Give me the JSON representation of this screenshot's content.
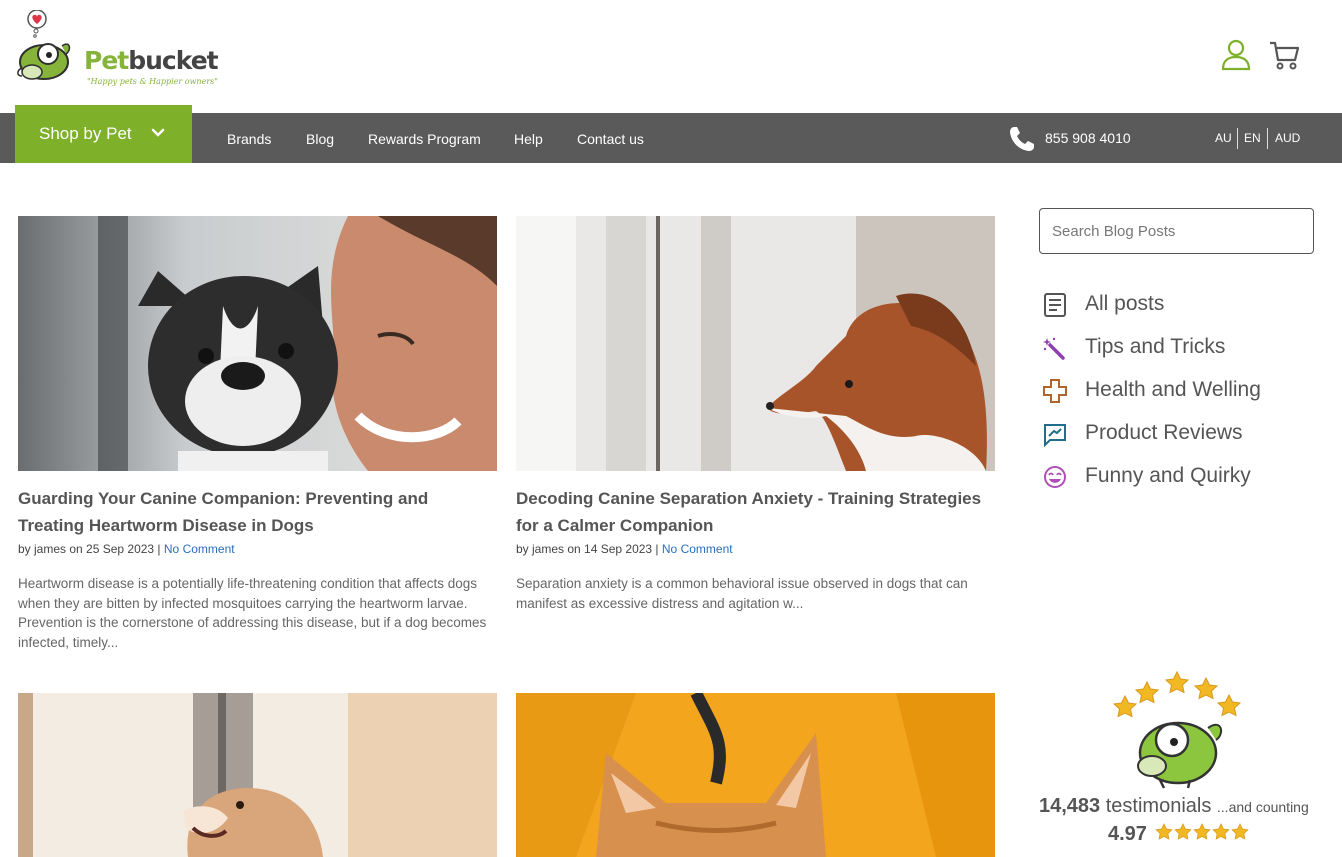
{
  "brand": {
    "name_part1": "Pet",
    "name_part2": "bucket",
    "tagline": "\"Happy pets & Happier owners\""
  },
  "header": {
    "icons": [
      "user-icon",
      "cart-icon"
    ]
  },
  "nav": {
    "shop_by_pet": "Shop by Pet",
    "links": [
      "Brands",
      "Blog",
      "Rewards Program",
      "Help",
      "Contact us"
    ],
    "phone": "855 908 4010",
    "locale": [
      "AU",
      "EN",
      "AUD"
    ]
  },
  "colors": {
    "brand_green": "#7eb02a",
    "nav_gray": "#5a5a5a",
    "link_blue": "#2a6ebb"
  },
  "posts": [
    {
      "title": "Guarding Your Canine Companion: Preventing and Treating Heartworm Disease in Dogs",
      "meta": "by james on 25 Sep 2023 |",
      "comments": "No Comment",
      "excerpt": "Heartworm disease is a potentially life-threatening condition that affects dogs when they are bitten by infected mosquitoes carrying the heartworm larvae. Prevention is the cornerstone of addressing this disease, but if a dog becomes infected, timely..."
    },
    {
      "title": "Decoding Canine Separation Anxiety - Training Strategies for a Calmer Companion",
      "meta": "by james on 14 Sep 2023 |",
      "comments": "No Comment",
      "excerpt": "Separation anxiety is a common behavioral issue observed in dogs that can manifest as excessive distress and agitation w..."
    }
  ],
  "sidebar": {
    "search_placeholder": "Search Blog Posts",
    "categories": [
      {
        "label": "All posts",
        "icon": "document-icon"
      },
      {
        "label": "Tips and Tricks",
        "icon": "magic-wand-icon"
      },
      {
        "label": "Health and Welling",
        "icon": "medical-cross-icon"
      },
      {
        "label": "Product Reviews",
        "icon": "review-icon"
      },
      {
        "label": "Funny and Quirky",
        "icon": "smiley-icon"
      }
    ],
    "testimonials": {
      "count": "14,483",
      "label": "testimonials",
      "suffix": "...and counting",
      "rating": "4.97",
      "stars": 5
    }
  }
}
